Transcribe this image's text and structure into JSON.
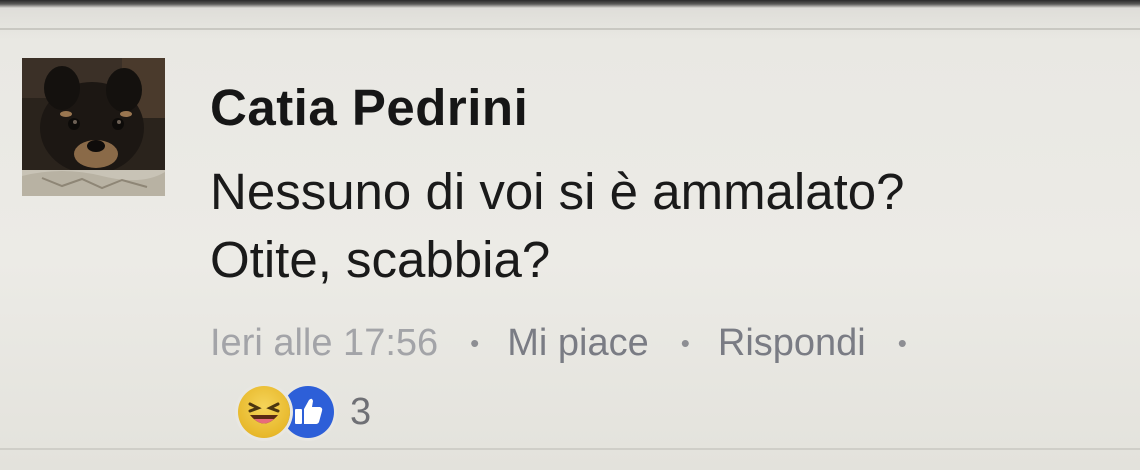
{
  "comment": {
    "author": "Catia Pedrini",
    "message_lines": [
      "Nessuno di voi si è ammalato?",
      "Otite, scabbia?"
    ],
    "timestamp": "Ieri alle 17:56",
    "like_label": "Mi piace",
    "reply_label": "Rispondi",
    "separator": "•",
    "reactions": {
      "icons": [
        "haha-icon",
        "like-icon"
      ],
      "count": "3"
    },
    "avatar": "dog-photo"
  },
  "colors": {
    "background": "#e7e6e1",
    "author_text": "#161616",
    "meta_text": "#85868c",
    "like_blue": "#2d5fd8",
    "haha_yellow": "#e8b92c"
  }
}
